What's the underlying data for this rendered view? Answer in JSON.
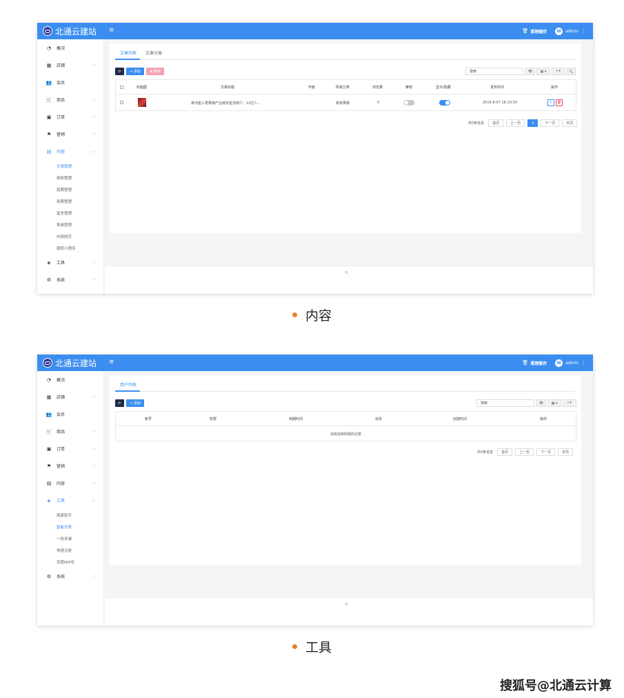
{
  "app": {
    "brand_name": "北通云建站",
    "menu_toggle": "≡",
    "clear_cache": "清理缓存",
    "avatar_initial": "W",
    "user": "admin",
    "more": "⋮",
    "accent_color": "#3b8ef0"
  },
  "sidebar": {
    "items": [
      {
        "label": "概况",
        "icon": "dashboard-icon"
      },
      {
        "label": "店铺",
        "icon": "grid-icon",
        "arrow": true
      },
      {
        "label": "会员",
        "icon": "users-icon"
      },
      {
        "label": "商品",
        "icon": "cart-icon",
        "arrow": true
      },
      {
        "label": "订单",
        "icon": "money-icon",
        "arrow": true
      },
      {
        "label": "营销",
        "icon": "flag-icon",
        "arrow": true
      },
      {
        "label": "内容",
        "icon": "document-icon",
        "arrow": true
      },
      {
        "label": "工具",
        "icon": "cube-icon",
        "arrow": true
      },
      {
        "label": "系统",
        "icon": "gear-icon",
        "arrow": true
      }
    ],
    "content_sub": [
      "文章管理",
      "相册管理",
      "招聘管理",
      "投票管理",
      "留言管理",
      "表单管理",
      "内部网页",
      "跳转小程序"
    ],
    "tools_sub": [
      "商家助手",
      "智能识表",
      "一码多端",
      "快速注册",
      "百度MIP化"
    ]
  },
  "screen1": {
    "tabs": [
      "文章列表",
      "文章分类"
    ],
    "buttons": {
      "refresh": "⟳",
      "add": "+ 添加",
      "delete": "✖ 删除"
    },
    "search_placeholder": "搜索",
    "toolbar": {
      "view": "👁",
      "columns": "▦ ▾",
      "export": "⭳ ▾",
      "search": "🔍"
    },
    "columns": [
      "封面图",
      "文章标题",
      "作者",
      "所属分类",
      "浏览量",
      "推荐",
      "显示/隐藏",
      "发布时间",
      "操作"
    ],
    "rows": [
      {
        "title": "黄河金三角果蔬产业链资金流简介：12亿人...",
        "author": "",
        "category": "新鲜果蔬",
        "views": "0",
        "recommend": false,
        "visible": true,
        "time": "2019-8-07 18:10:30"
      }
    ],
    "pager": {
      "info": "共0条信息",
      "first": "首页",
      "prev": "上一页",
      "current": "1",
      "next": "下一页",
      "last": "末页"
    },
    "footer": "©"
  },
  "screen2": {
    "tabs": [
      "用户列表"
    ],
    "buttons": {
      "refresh": "⟳",
      "add": "+ 添加"
    },
    "search_placeholder": "搜索",
    "toolbar": {
      "view": "👁",
      "columns": "▦ ▾",
      "export": "⭳ ▾"
    },
    "columns": [
      "账号",
      "权限",
      "到期时间",
      "状态",
      "创建时间",
      "操作"
    ],
    "empty": "没有找到匹配的记录",
    "pager": {
      "info": "共0条信息",
      "first": "首页",
      "prev": "上一页",
      "next": "下一页",
      "last": "末页"
    },
    "footer": "©"
  },
  "captions": [
    "内容",
    "工具"
  ],
  "watermark": "搜狐号@北通云计算"
}
